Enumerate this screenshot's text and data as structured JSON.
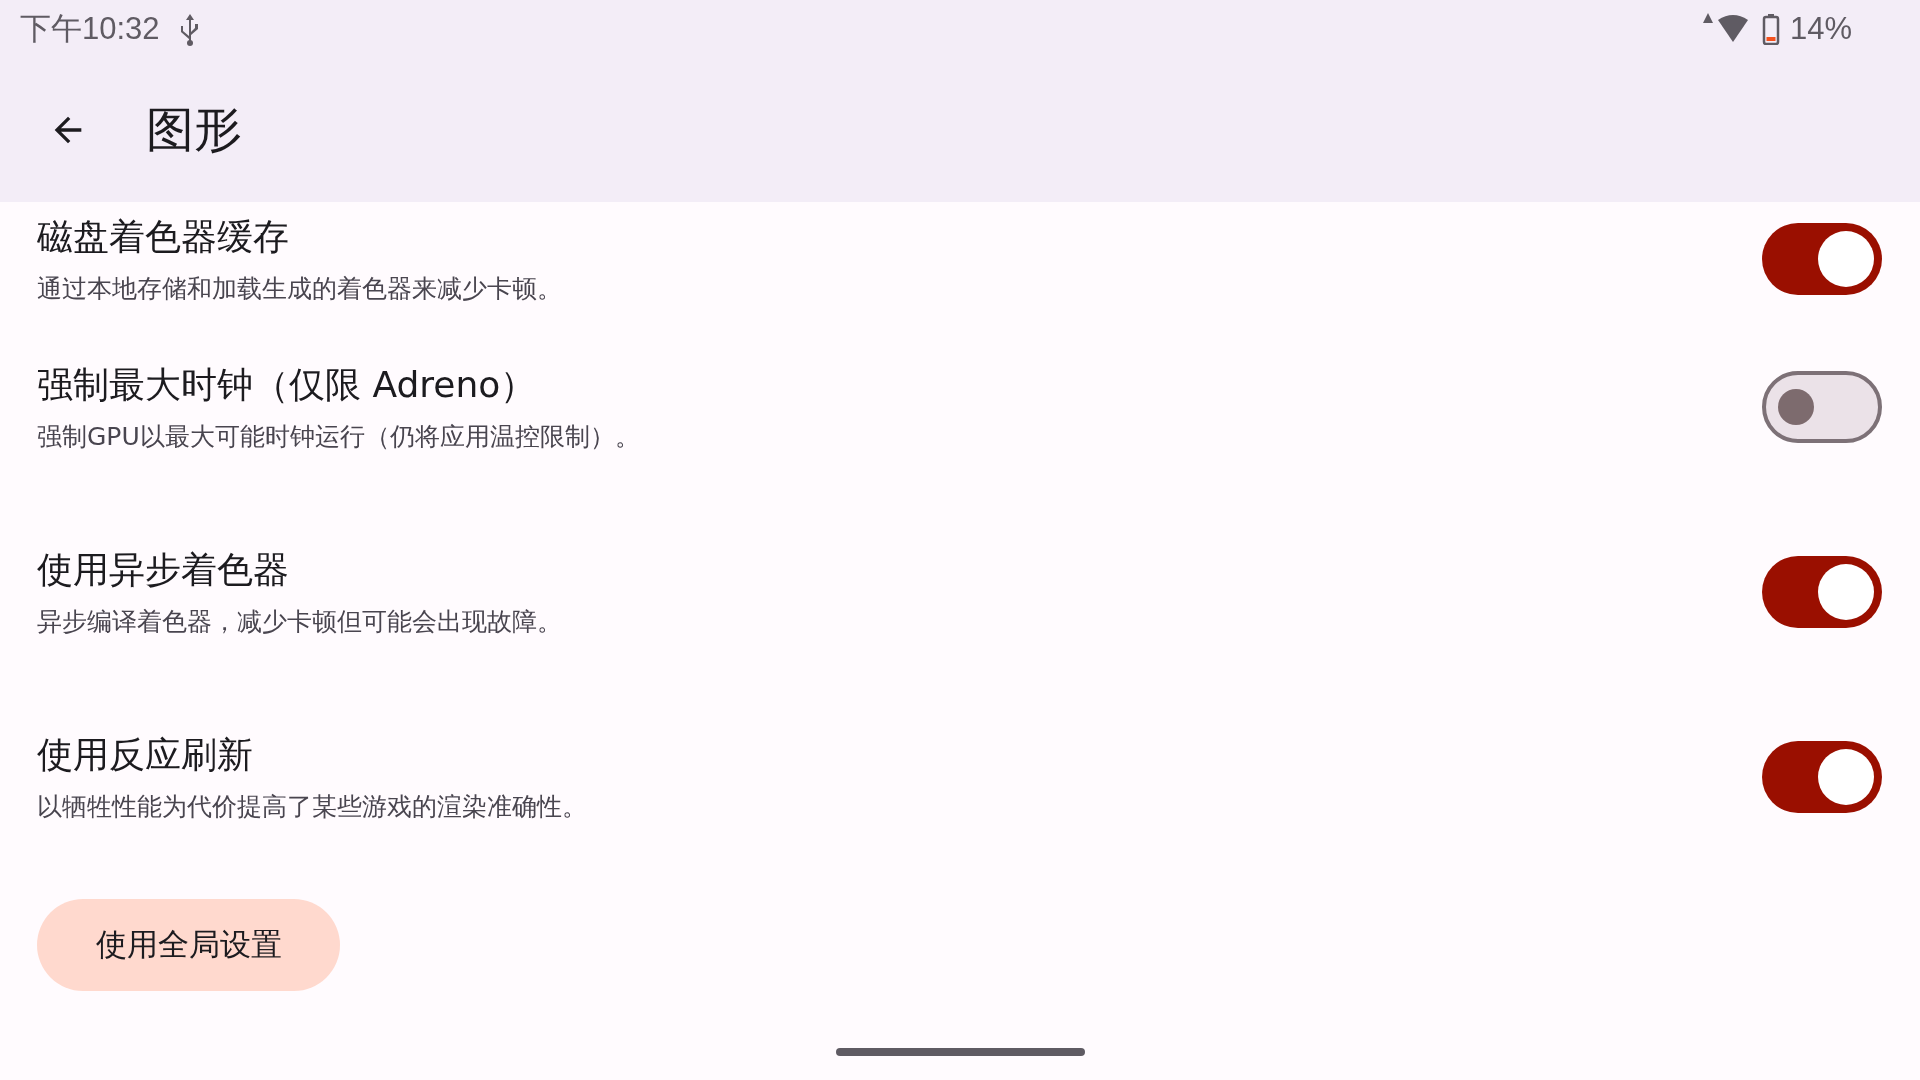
{
  "status_bar": {
    "time": "下午10:32",
    "battery": "14%"
  },
  "header": {
    "title": "图形"
  },
  "settings": [
    {
      "title": "磁盘着色器缓存",
      "description": "通过本地存储和加载生成的着色器来减少卡顿。",
      "on": true
    },
    {
      "title": "强制最大时钟（仅限 Adreno）",
      "description": "强制GPU以最大可能时钟运行（仍将应用温控限制）。",
      "on": false
    },
    {
      "title": "使用异步着色器",
      "description": "异步编译着色器，减少卡顿但可能会出现故障。",
      "on": true
    },
    {
      "title": "使用反应刷新",
      "description": "以牺牲性能为代价提高了某些游戏的渲染准确性。",
      "on": true
    }
  ],
  "reset_button": {
    "label": "使用全局设置"
  }
}
